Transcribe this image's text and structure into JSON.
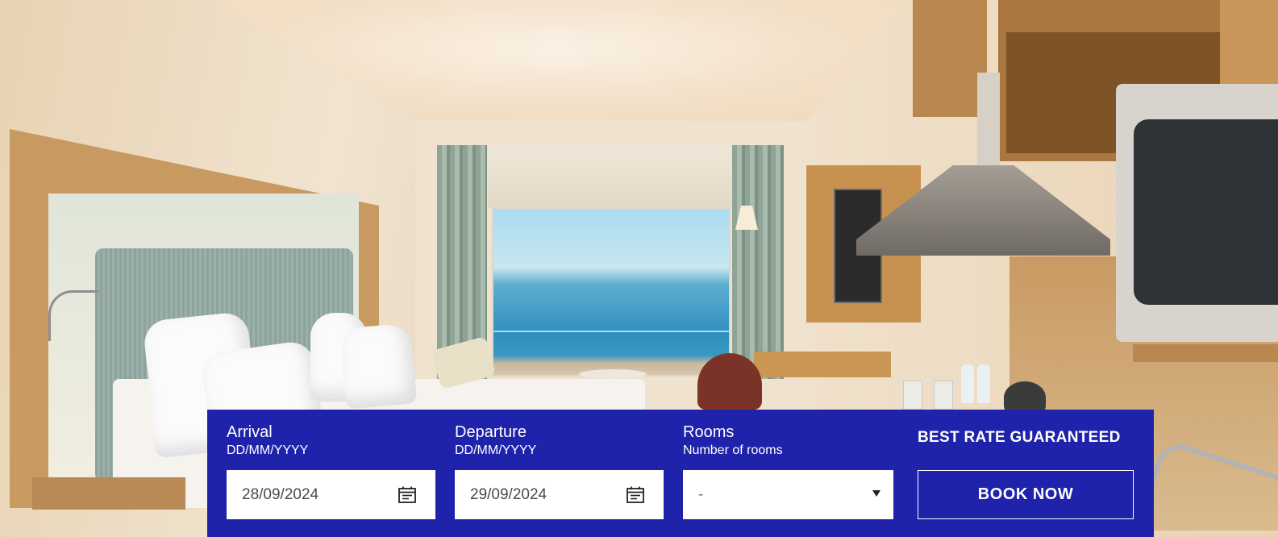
{
  "booking": {
    "arrival": {
      "label": "Arrival",
      "hint": "DD/MM/YYYY",
      "value": "28/09/2024",
      "icon": "calendar-icon"
    },
    "departure": {
      "label": "Departure",
      "hint": "DD/MM/YYYY",
      "value": "29/09/2024",
      "icon": "calendar-icon"
    },
    "rooms": {
      "label": "Rooms",
      "hint": "Number of rooms",
      "selected": "-",
      "icon": "chevron-down-icon"
    },
    "best_rate": "BEST RATE GUARANTEED",
    "book_now": "BOOK NOW"
  },
  "colors": {
    "booking_bar": "#1f22ab",
    "input_bg": "#ffffff",
    "text_on_bar": "#ffffff"
  }
}
